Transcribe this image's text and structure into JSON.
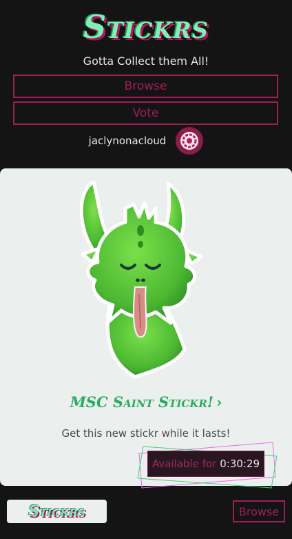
{
  "header": {
    "logo_text": "Stickrs",
    "tagline": "Gotta Collect them All!",
    "nav": {
      "browse_label": "Browse",
      "vote_label": "Vote"
    },
    "user": {
      "username": "jaclynonacloud",
      "avatar_icon": "avatar-swirl-icon"
    }
  },
  "featured": {
    "image_icon": "green-creature-sticker",
    "title": "MSC Saint Stickr!",
    "chevron": "›",
    "description": "Get this new stickr while it lasts!",
    "timer": {
      "label": "Available for",
      "value": "0:30:29"
    }
  },
  "footer": {
    "logo_text": "Stickrs",
    "browse_label": "Browse"
  },
  "colors": {
    "background": "#141414",
    "accent": "#a01e58",
    "brand_green": "#7ff0b2",
    "title_green": "#2aab5f",
    "card": "#ebefed"
  }
}
